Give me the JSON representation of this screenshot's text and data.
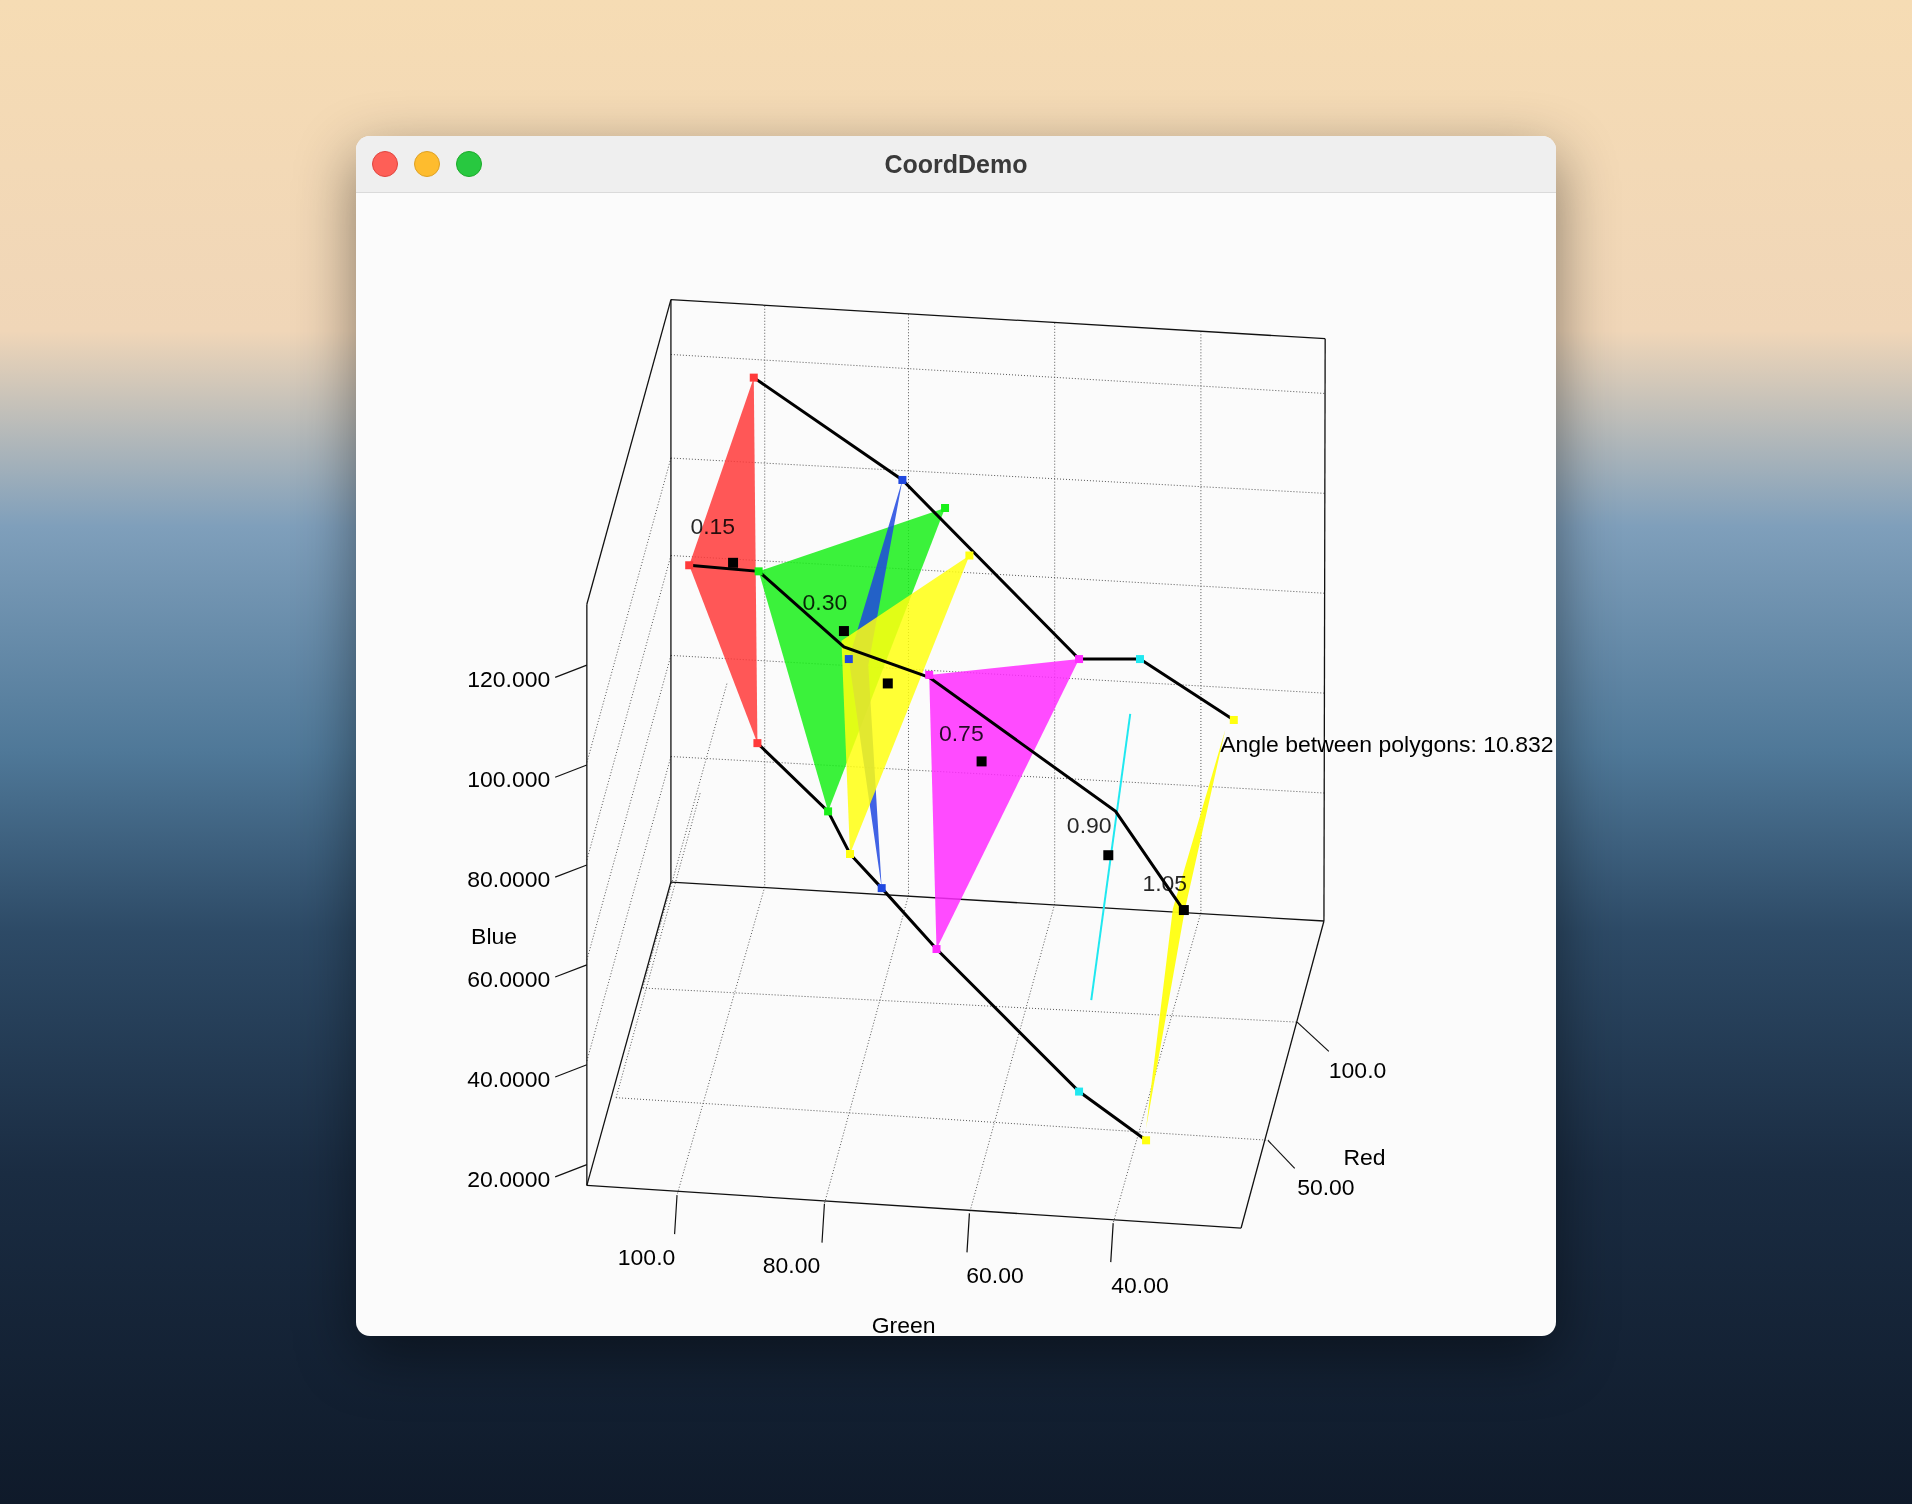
{
  "window": {
    "title": "CoordDemo"
  },
  "plot": {
    "axes": [
      {
        "name": "Blue",
        "ticks": [
          "120.000",
          "100.000",
          "80.0000",
          "60.0000",
          "40.0000",
          "20.0000"
        ]
      },
      {
        "name": "Green",
        "ticks": [
          "100.0",
          "80.00",
          "60.00",
          "40.00"
        ]
      },
      {
        "name": "Red",
        "ticks": [
          "100.0",
          "50.00"
        ]
      }
    ],
    "polygons": [
      {
        "kind": "triangle",
        "label": "0.15",
        "color": "#ff3a3a"
      },
      {
        "kind": "triangle",
        "label": "0.30",
        "color": "#19f019"
      },
      {
        "kind": "triangle",
        "color": "#2048e0"
      },
      {
        "kind": "triangle",
        "color": "#ffff10"
      },
      {
        "kind": "triangle",
        "label": "0.75",
        "color": "#ff2cff"
      },
      {
        "kind": "line",
        "label": "0.90",
        "color": "#20e8f0"
      },
      {
        "kind": "sliver",
        "label": "1.05",
        "color": "#ffff10"
      }
    ],
    "annotation": "Angle between polygons: 10.832"
  }
}
